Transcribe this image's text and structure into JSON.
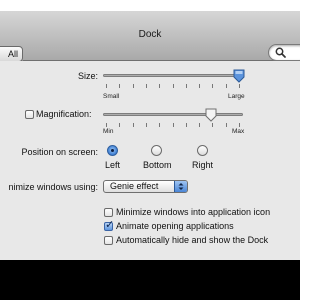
{
  "window": {
    "title": "Dock"
  },
  "toolbar": {
    "show_all_label": "All",
    "search": {
      "icon": "search-icon",
      "value": ""
    }
  },
  "size": {
    "label": "Size:",
    "min_label": "Small",
    "max_label": "Large",
    "value_fraction": 1.0
  },
  "magnification": {
    "label": "Magnification:",
    "enabled": false,
    "min_label": "Min",
    "max_label": "Max",
    "value_fraction": 0.82
  },
  "position": {
    "label": "Position on screen:",
    "options": [
      "Left",
      "Bottom",
      "Right"
    ],
    "selected": "Left"
  },
  "minimize": {
    "label": "nimize windows using:",
    "selected_effect": "Genie effect"
  },
  "options": [
    {
      "label": "Minimize windows into application icon",
      "checked": false
    },
    {
      "label": "Animate opening applications",
      "checked": true
    },
    {
      "label": "Automatically hide and show the Dock",
      "checked": false
    }
  ],
  "colors": {
    "accent": "#3d7fd4",
    "pane_background": "#e8e8e8"
  }
}
